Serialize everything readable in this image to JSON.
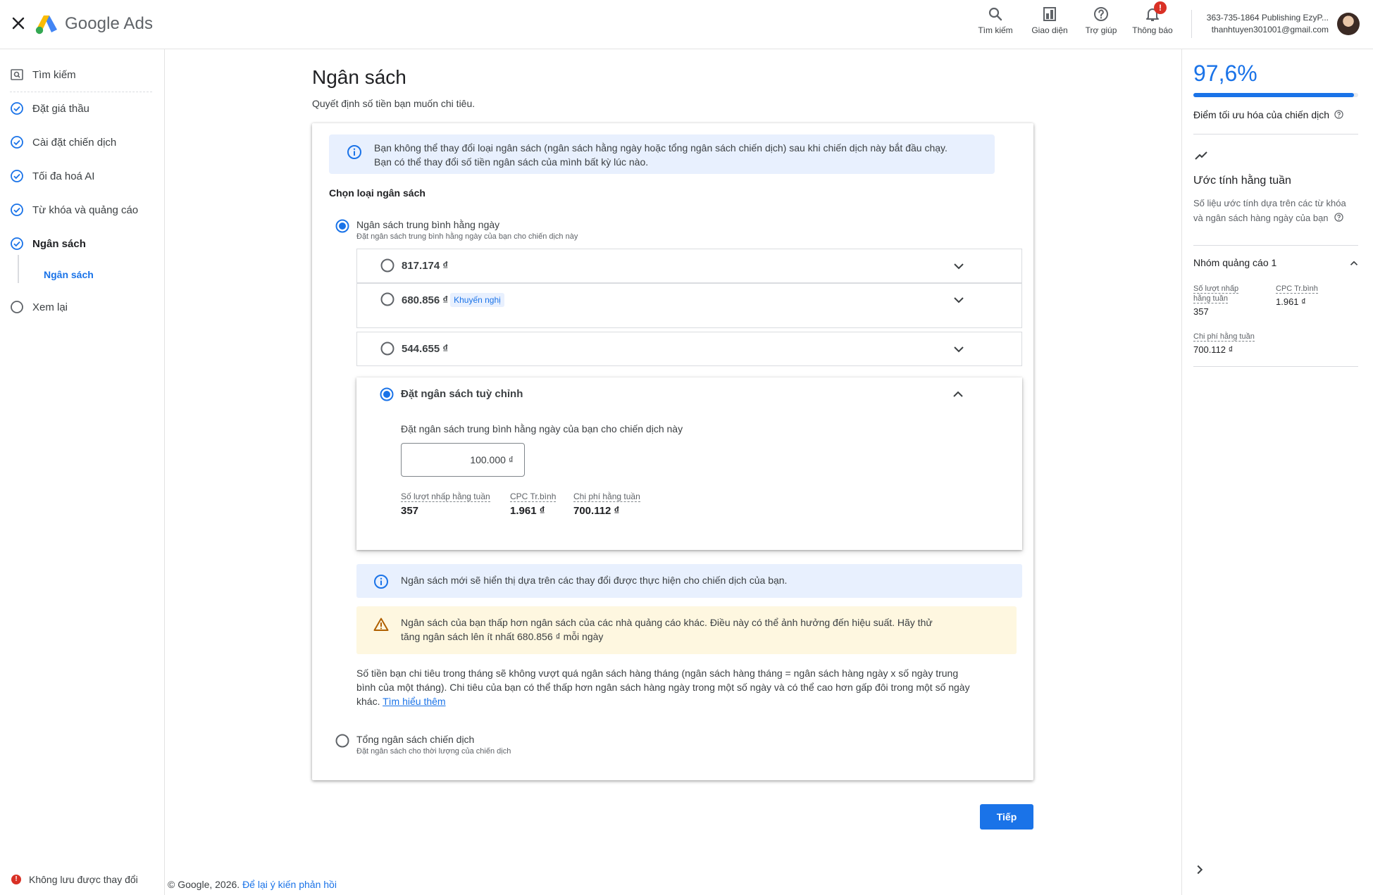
{
  "header": {
    "brand": "Google Ads",
    "nav": [
      {
        "label": "Tìm kiếm",
        "icon": "search-icon"
      },
      {
        "label": "Giao diện",
        "icon": "appearance-icon"
      },
      {
        "label": "Trợ giúp",
        "icon": "help-icon"
      },
      {
        "label": "Thông báo",
        "icon": "bell-icon",
        "badge": "!"
      }
    ],
    "account_line1": "363-735-1864 Publishing EzyP...",
    "account_line2": "thanhtuyen301001@gmail.com"
  },
  "sidebar": {
    "items": [
      {
        "label": "Tìm kiếm",
        "state": "search"
      },
      {
        "label": "Đặt giá thầu",
        "state": "done"
      },
      {
        "label": "Cài đặt chiến dịch",
        "state": "done"
      },
      {
        "label": "Tối đa hoá AI",
        "state": "done"
      },
      {
        "label": "Từ khóa và quảng cáo",
        "state": "done"
      },
      {
        "label": "Ngân sách",
        "state": "active"
      },
      {
        "label": "Ngân sách",
        "state": "sub-active"
      },
      {
        "label": "Xem lại",
        "state": "todo"
      }
    ],
    "unsaved_badge": "!",
    "unsaved": "Không lưu được thay đổi"
  },
  "main": {
    "title": "Ngân sách",
    "subtitle": "Quyết định số tiền bạn muốn chi tiêu.",
    "info_line1": "Bạn không thể thay đổi loại ngân sách (ngân sách hằng ngày hoặc tổng ngân sách chiến dịch) sau khi chiến dịch này bắt đầu chạy.",
    "info_line2": "Bạn có thể thay đổi số tiền ngân sách của mình bất kỳ lúc nào.",
    "choose_type": "Chọn loại ngân sách",
    "daily": {
      "title": "Ngân sách trung bình hằng ngày",
      "sub": "Đặt ngân sách trung bình hằng ngày của bạn cho chiến dịch này",
      "selected": true
    },
    "options": [
      {
        "amount": "817.174 ₫",
        "badge": ""
      },
      {
        "amount": "680.856 ₫",
        "badge": "Khuyến nghị"
      },
      {
        "amount": "544.655 ₫",
        "badge": ""
      }
    ],
    "custom": {
      "title": "Đặt ngân sách tuỳ chỉnh",
      "prompt": "Đặt ngân sách trung bình hằng ngày của bạn cho chiến dịch này",
      "value": "100.000 ₫",
      "stats": [
        {
          "label": "Số lượt nhấp hằng tuần",
          "value": "357"
        },
        {
          "label": "CPC Tr.bình",
          "value": "1.961 ₫"
        },
        {
          "label": "Chi phí hằng tuần",
          "value": "700.112 ₫"
        }
      ]
    },
    "note": "Ngân sách mới sẽ hiển thị dựa trên các thay đổi được thực hiện cho chiến dịch của bạn.",
    "warning_line1": "Ngân sách của bạn thấp hơn ngân sách của các nhà quảng cáo khác. Điều này có thể ảnh hưởng đến hiệu suất. Hãy thử",
    "warning_line2": "tăng ngân sách lên ít nhất 680.856 ₫ mỗi ngày",
    "body": "Số tiền bạn chi tiêu trong tháng sẽ không vượt quá ngân sách hàng tháng (ngân sách hàng tháng = ngân sách hàng ngày x số ngày trung bình của một tháng). Chi tiêu của bạn có thể thấp hơn ngân sách hàng ngày trong một số ngày và có thể cao hơn gấp đôi trong một số ngày khác.",
    "learn_more": "Tìm hiểu thêm",
    "total": {
      "title": "Tổng ngân sách chiến dịch",
      "sub": "Đặt ngân sách cho thời lượng của chiến dịch"
    },
    "next": "Tiếp"
  },
  "footer": {
    "copyright": "© Google, 2026.",
    "feedback": "Để lại ý kiến phản hồi"
  },
  "right_panel": {
    "score": "97,6%",
    "score_fraction": 0.976,
    "score_label": "Điểm tối ưu hóa của chiến dịch",
    "estimate_title": "Ước tính hằng tuần",
    "estimate_desc": "Số liệu ước tính dựa trên các từ khóa và ngân sách hàng ngày của bạn",
    "group": "Nhóm quảng cáo 1",
    "stats": [
      {
        "label": "Số lượt nhấp hằng tuần",
        "value": "357"
      },
      {
        "label": "CPC Tr.bình",
        "value": "1.961 ₫"
      },
      {
        "label": "Chi phí hằng tuần",
        "value": "700.112 ₫"
      }
    ]
  },
  "colors": {
    "accent": "#1a73e8",
    "error": "#d93025",
    "warning_bg": "#fef7e0",
    "info_bg": "#e8f0fe"
  }
}
